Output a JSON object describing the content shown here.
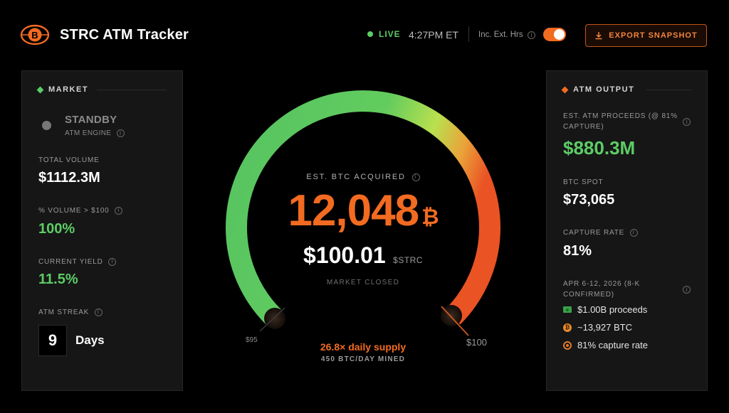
{
  "header": {
    "title": "STRC ATM Tracker",
    "live_label": "LIVE",
    "time": "4:27PM ET",
    "ext_hours_label": "Inc. Ext. Hrs",
    "ext_hours_enabled": true,
    "export_label": "EXPORT SNAPSHOT"
  },
  "market_panel": {
    "title": "MARKET",
    "engine_status": "STANDBY",
    "engine_label": "ATM ENGINE",
    "total_volume_label": "TOTAL VOLUME",
    "total_volume": "$1112.3M",
    "pct_volume_label": "% VOLUME > $100",
    "pct_volume": "100%",
    "yield_label": "CURRENT YIELD",
    "yield": "11.5%",
    "streak_label": "ATM STREAK",
    "streak_value": "9",
    "streak_unit": "Days"
  },
  "gauge": {
    "est_label": "EST. BTC ACQUIRED",
    "btc_acquired": "12,048",
    "btc_symbol": "₿",
    "price": "$100.01",
    "ticker": "$STRC",
    "market_state": "MARKET CLOSED",
    "min_label": "$95",
    "max_label": "$100",
    "supply_text": "26.8× daily supply",
    "mined_text": "450 BTC/DAY MINED"
  },
  "output_panel": {
    "title": "ATM OUTPUT",
    "proceeds_label": "EST. ATM PROCEEDS (@ 81% CAPTURE)",
    "proceeds": "$880.3M",
    "btc_spot_label": "BTC SPOT",
    "btc_spot": "$73,065",
    "capture_label": "CAPTURE RATE",
    "capture": "81%",
    "week_label": "APR 6-12, 2026 (8-K CONFIRMED)",
    "week_items": [
      {
        "icon": "cash-icon",
        "text": "$1.00B proceeds"
      },
      {
        "icon": "bitcoin-icon",
        "text": "~13,927 BTC"
      },
      {
        "icon": "target-icon",
        "text": "81% capture rate"
      }
    ]
  },
  "colors": {
    "accent": "#f26b21",
    "positive": "#5ccc66",
    "gauge_start": "#55c361",
    "gauge_mid": "#b9e04e",
    "gauge_end": "#ea5324"
  }
}
